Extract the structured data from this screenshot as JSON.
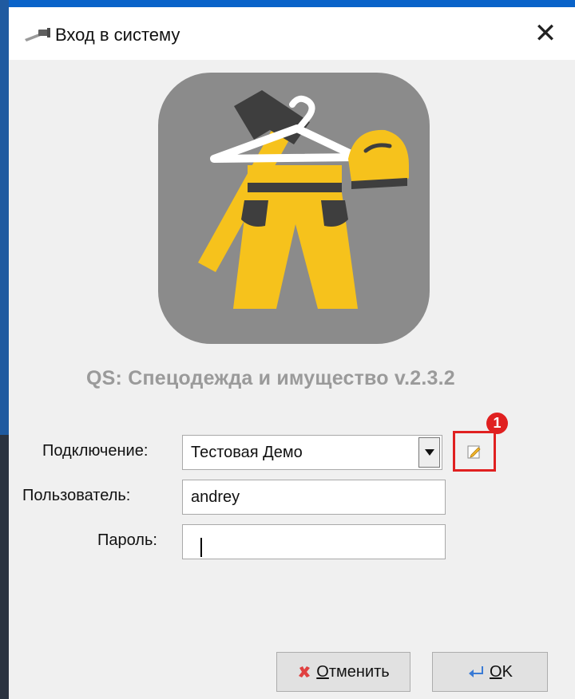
{
  "window": {
    "title": "Вход в систему",
    "close_glyph": "✕",
    "title_icon": "hammer-icon"
  },
  "app": {
    "logo_icon": "workwear-logo-icon",
    "title": "QS: Спецодежда и имущество v.2.3.2"
  },
  "form": {
    "connection_label": "Подключение:",
    "connection_value": "Тестовая Демо",
    "edit_connection_icon": "edit-icon",
    "badge_number": "1",
    "user_label": "Пользователь:",
    "user_value": "andrey",
    "password_label": "Пароль:",
    "password_value": ""
  },
  "buttons": {
    "cancel_accel": "О",
    "cancel_rest": "тменить",
    "ok_accel": "O",
    "ok_rest": "K"
  },
  "colors": {
    "logo_bg": "#8b8b8b",
    "logo_yellow": "#f6c21c",
    "logo_dark": "#3e3e3e",
    "highlight": "#e02020",
    "title_gray": "#9a9a9a"
  }
}
